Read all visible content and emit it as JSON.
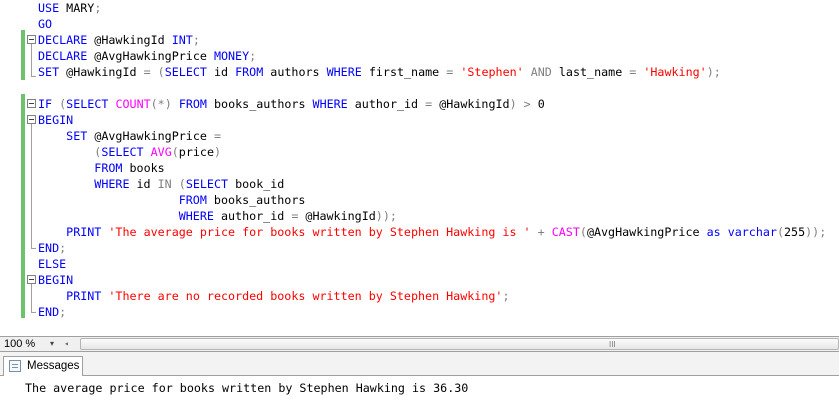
{
  "editor": {
    "lines": [
      {
        "tokens": [
          {
            "t": "USE",
            "c": "kw"
          },
          {
            "t": " MARY",
            "c": ""
          },
          {
            "t": ";",
            "c": "op"
          }
        ]
      },
      {
        "tokens": [
          {
            "t": "GO",
            "c": "kw"
          }
        ]
      },
      {
        "tokens": [
          {
            "t": "DECLARE",
            "c": "kw"
          },
          {
            "t": " @HawkingId ",
            "c": ""
          },
          {
            "t": "INT",
            "c": "kw"
          },
          {
            "t": ";",
            "c": "op"
          }
        ]
      },
      {
        "tokens": [
          {
            "t": "DECLARE",
            "c": "kw"
          },
          {
            "t": " @AvgHawkingPrice ",
            "c": ""
          },
          {
            "t": "MONEY",
            "c": "kw"
          },
          {
            "t": ";",
            "c": "op"
          }
        ]
      },
      {
        "tokens": [
          {
            "t": "SET",
            "c": "kw"
          },
          {
            "t": " @HawkingId ",
            "c": ""
          },
          {
            "t": "=",
            "c": "op"
          },
          {
            "t": " ",
            "c": ""
          },
          {
            "t": "(",
            "c": "op"
          },
          {
            "t": "SELECT",
            "c": "kw"
          },
          {
            "t": " id ",
            "c": ""
          },
          {
            "t": "FROM",
            "c": "kw"
          },
          {
            "t": " authors ",
            "c": ""
          },
          {
            "t": "WHERE",
            "c": "kw"
          },
          {
            "t": " first_name ",
            "c": ""
          },
          {
            "t": "=",
            "c": "op"
          },
          {
            "t": " ",
            "c": ""
          },
          {
            "t": "'Stephen'",
            "c": "str"
          },
          {
            "t": " ",
            "c": ""
          },
          {
            "t": "AND",
            "c": "op"
          },
          {
            "t": " last_name ",
            "c": ""
          },
          {
            "t": "=",
            "c": "op"
          },
          {
            "t": " ",
            "c": ""
          },
          {
            "t": "'Hawking'",
            "c": "str"
          },
          {
            "t": ");",
            "c": "op"
          }
        ]
      },
      {
        "tokens": []
      },
      {
        "tokens": [
          {
            "t": "IF",
            "c": "kw"
          },
          {
            "t": " ",
            "c": ""
          },
          {
            "t": "(",
            "c": "op"
          },
          {
            "t": "SELECT",
            "c": "kw"
          },
          {
            "t": " ",
            "c": ""
          },
          {
            "t": "COUNT",
            "c": "fn"
          },
          {
            "t": "(*)",
            "c": "op"
          },
          {
            "t": " ",
            "c": ""
          },
          {
            "t": "FROM",
            "c": "kw"
          },
          {
            "t": " books_authors ",
            "c": ""
          },
          {
            "t": "WHERE",
            "c": "kw"
          },
          {
            "t": " author_id ",
            "c": ""
          },
          {
            "t": "=",
            "c": "op"
          },
          {
            "t": " @HawkingId",
            "c": ""
          },
          {
            "t": ")",
            "c": "op"
          },
          {
            "t": " ",
            "c": ""
          },
          {
            "t": ">",
            "c": "op"
          },
          {
            "t": " 0",
            "c": ""
          }
        ]
      },
      {
        "tokens": [
          {
            "t": "BEGIN",
            "c": "kw"
          }
        ]
      },
      {
        "tokens": [
          {
            "t": "    ",
            "c": ""
          },
          {
            "t": "SET",
            "c": "kw"
          },
          {
            "t": " @AvgHawkingPrice ",
            "c": ""
          },
          {
            "t": "=",
            "c": "op"
          }
        ]
      },
      {
        "tokens": [
          {
            "t": "        ",
            "c": ""
          },
          {
            "t": "(",
            "c": "op"
          },
          {
            "t": "SELECT",
            "c": "kw"
          },
          {
            "t": " ",
            "c": ""
          },
          {
            "t": "AVG",
            "c": "fn"
          },
          {
            "t": "(",
            "c": "op"
          },
          {
            "t": "price",
            "c": ""
          },
          {
            "t": ")",
            "c": "op"
          }
        ]
      },
      {
        "tokens": [
          {
            "t": "        ",
            "c": ""
          },
          {
            "t": "FROM",
            "c": "kw"
          },
          {
            "t": " books",
            "c": ""
          }
        ]
      },
      {
        "tokens": [
          {
            "t": "        ",
            "c": ""
          },
          {
            "t": "WHERE",
            "c": "kw"
          },
          {
            "t": " id ",
            "c": ""
          },
          {
            "t": "IN",
            "c": "op"
          },
          {
            "t": " ",
            "c": ""
          },
          {
            "t": "(",
            "c": "op"
          },
          {
            "t": "SELECT",
            "c": "kw"
          },
          {
            "t": " book_id",
            "c": ""
          }
        ]
      },
      {
        "tokens": [
          {
            "t": "                    ",
            "c": ""
          },
          {
            "t": "FROM",
            "c": "kw"
          },
          {
            "t": " books_authors",
            "c": ""
          }
        ]
      },
      {
        "tokens": [
          {
            "t": "                    ",
            "c": ""
          },
          {
            "t": "WHERE",
            "c": "kw"
          },
          {
            "t": " author_id ",
            "c": ""
          },
          {
            "t": "=",
            "c": "op"
          },
          {
            "t": " @HawkingId",
            "c": ""
          },
          {
            "t": "));",
            "c": "op"
          }
        ]
      },
      {
        "tokens": [
          {
            "t": "    ",
            "c": ""
          },
          {
            "t": "PRINT",
            "c": "kw"
          },
          {
            "t": " ",
            "c": ""
          },
          {
            "t": "'The average price for books written by Stephen Hawking is '",
            "c": "str"
          },
          {
            "t": " ",
            "c": ""
          },
          {
            "t": "+",
            "c": "op"
          },
          {
            "t": " ",
            "c": ""
          },
          {
            "t": "CAST",
            "c": "fn"
          },
          {
            "t": "(",
            "c": "op"
          },
          {
            "t": "@AvgHawkingPrice ",
            "c": ""
          },
          {
            "t": "as",
            "c": "kw"
          },
          {
            "t": " ",
            "c": ""
          },
          {
            "t": "varchar",
            "c": "kw"
          },
          {
            "t": "(",
            "c": "op"
          },
          {
            "t": "255",
            "c": ""
          },
          {
            "t": "));",
            "c": "op"
          }
        ]
      },
      {
        "tokens": [
          {
            "t": "END",
            "c": "kw"
          },
          {
            "t": ";",
            "c": "op"
          }
        ]
      },
      {
        "tokens": [
          {
            "t": "ELSE",
            "c": "kw"
          }
        ]
      },
      {
        "tokens": [
          {
            "t": "BEGIN",
            "c": "kw"
          }
        ]
      },
      {
        "tokens": [
          {
            "t": "    ",
            "c": ""
          },
          {
            "t": "PRINT",
            "c": "kw"
          },
          {
            "t": " ",
            "c": ""
          },
          {
            "t": "'There are no recorded books written by Stephen Hawking'",
            "c": "str"
          },
          {
            "t": ";",
            "c": "op"
          }
        ]
      },
      {
        "tokens": [
          {
            "t": "END",
            "c": "kw"
          },
          {
            "t": ";",
            "c": "op"
          }
        ]
      }
    ]
  },
  "statusbar": {
    "zoom": "100 %",
    "zoom_arrow_icon": "▾",
    "scroll_left_icon": "◂",
    "grip_icon": "III"
  },
  "results": {
    "tab_label": "Messages",
    "message": "The average price for books written by Stephen Hawking is 36.30"
  },
  "colors": {
    "keyword": "#0000ff",
    "string": "#ff0000",
    "function": "#ff00ff",
    "operator": "#808080"
  }
}
